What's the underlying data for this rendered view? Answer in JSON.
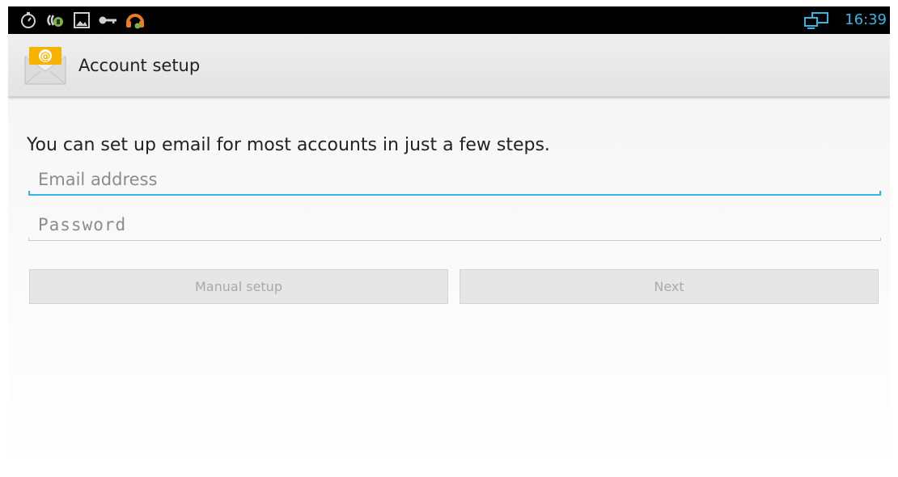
{
  "status_bar": {
    "time": "16:39",
    "icons": [
      "stopwatch-icon",
      "usb-debug-icon",
      "gallery-icon",
      "key-icon",
      "headset-icon",
      "screen-cast-icon"
    ],
    "clock_color": "#33b5e5"
  },
  "action_bar": {
    "title": "Account setup",
    "app_icon": "email-envelope-icon"
  },
  "main": {
    "intro_text": "You can set up email for most accounts in just a few steps.",
    "email": {
      "placeholder": "Email address",
      "value": ""
    },
    "password": {
      "placeholder": "Password",
      "value": ""
    },
    "buttons": {
      "manual_setup": "Manual setup",
      "next": "Next"
    }
  },
  "colors": {
    "accent": "#33b5e5",
    "status_bar_bg": "#000000",
    "disabled_text": "#a9a9a9"
  }
}
